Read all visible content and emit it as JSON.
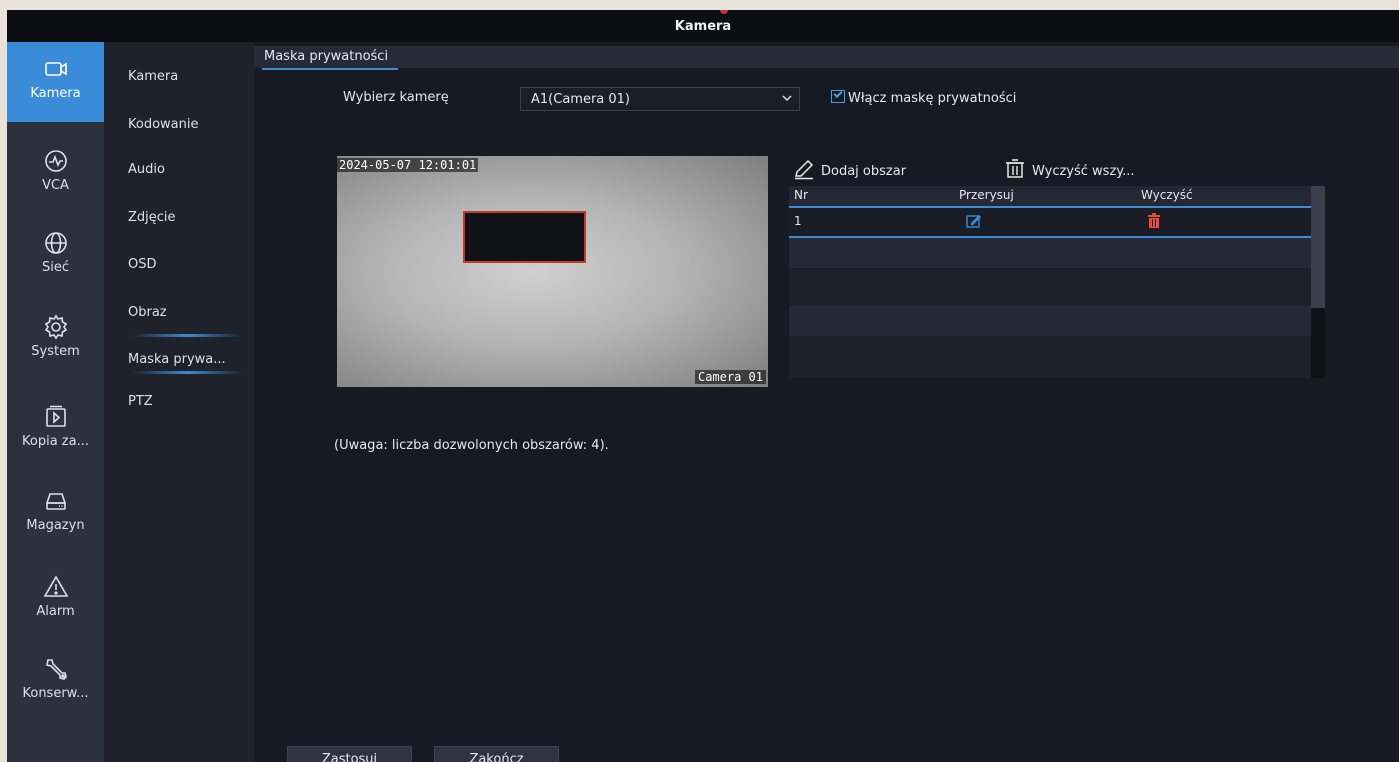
{
  "window": {
    "title": "Kamera"
  },
  "sidebar": {
    "items": [
      {
        "label": "Kamera",
        "icon": "camera-icon",
        "active": true
      },
      {
        "label": "VCA",
        "icon": "vca-icon"
      },
      {
        "label": "Sieć",
        "icon": "globe-icon"
      },
      {
        "label": "System",
        "icon": "gear-icon"
      },
      {
        "label": "Kopia za...",
        "icon": "backup-icon"
      },
      {
        "label": "Magazyn",
        "icon": "storage-icon"
      },
      {
        "label": "Alarm",
        "icon": "alarm-icon"
      },
      {
        "label": "Konserw...",
        "icon": "wrench-icon"
      }
    ]
  },
  "submenu": {
    "items": [
      {
        "label": "Kamera"
      },
      {
        "label": "Kodowanie"
      },
      {
        "label": "Audio"
      },
      {
        "label": "Zdjęcie"
      },
      {
        "label": "OSD"
      },
      {
        "label": "Obraz"
      },
      {
        "label": "Maska prywa...",
        "active": true
      },
      {
        "label": "PTZ"
      }
    ]
  },
  "tab": {
    "label": "Maska prywatności"
  },
  "form": {
    "camera_label": "Wybierz kamerę",
    "camera_value": "A1(Camera 01)",
    "enable_label": "Włącz maskę prywatności",
    "enable_checked": true
  },
  "preview": {
    "timestamp": "2024-05-07 12:01:01",
    "camera_name": "Camera 01"
  },
  "toolbar": {
    "add_label": "Dodaj obszar",
    "clear_all_label": "Wyczyść wszy..."
  },
  "table": {
    "headers": {
      "nr": "Nr",
      "redraw": "Przerysuj",
      "clear": "Wyczyść"
    },
    "rows": [
      {
        "nr": "1"
      }
    ]
  },
  "note": "(Uwaga: liczba dozwolonych obszarów: 4).",
  "buttons": {
    "apply": "Zastosuj",
    "exit": "Zakończ"
  },
  "colors": {
    "accent": "#3a8bd8",
    "danger": "#e74c3c",
    "background": "#171a22"
  }
}
